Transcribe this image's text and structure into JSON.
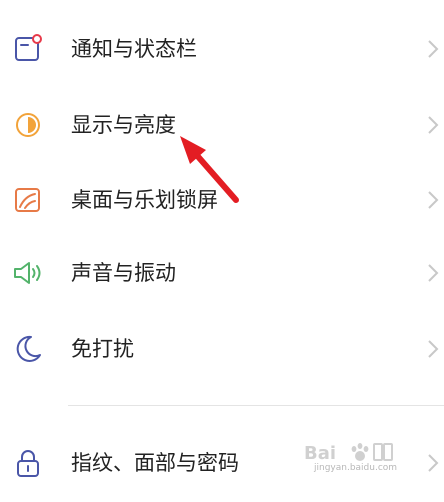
{
  "settings": {
    "items": [
      {
        "icon": "notification-icon",
        "label": "通知与状态栏"
      },
      {
        "icon": "display-brightness-icon",
        "label": "显示与亮度"
      },
      {
        "icon": "wallpaper-icon",
        "label": "桌面与乐划锁屏"
      },
      {
        "icon": "speaker-icon",
        "label": "声音与振动"
      },
      {
        "icon": "moon-icon",
        "label": "免打扰"
      },
      {
        "icon": "lock-icon",
        "label": "指纹、面部与密码"
      }
    ]
  },
  "watermark": {
    "logo_text": "Bai",
    "sub_text": "jingyan.baidu.com"
  },
  "colors": {
    "text": "#222222",
    "chevron": "#c8c8c8",
    "annotation_arrow": "#e31d23"
  }
}
